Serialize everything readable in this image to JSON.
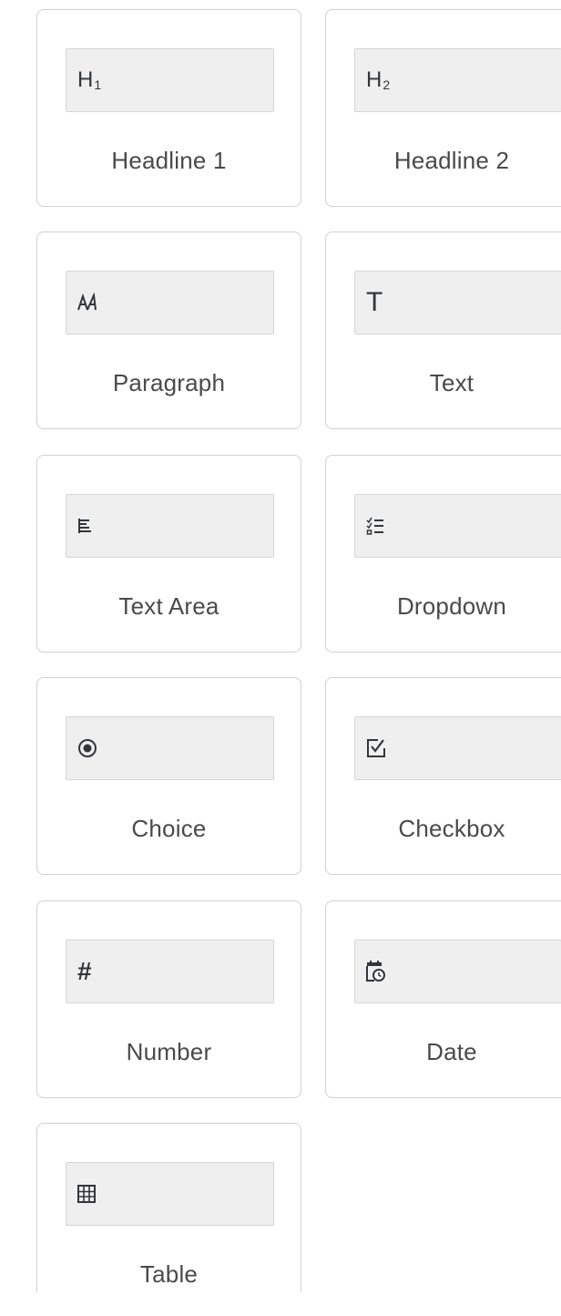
{
  "palette": {
    "items": [
      {
        "label": "Headline 1",
        "icon": "headline-1-icon",
        "icon_text": "H",
        "icon_sub": "1"
      },
      {
        "label": "Headline 2",
        "icon": "headline-2-icon",
        "icon_text": "H",
        "icon_sub": "2"
      },
      {
        "label": "Paragraph",
        "icon": "paragraph-icon"
      },
      {
        "label": "Text",
        "icon": "text-icon",
        "icon_text": "T"
      },
      {
        "label": "Text Area",
        "icon": "text-area-icon"
      },
      {
        "label": "Dropdown",
        "icon": "dropdown-list-icon"
      },
      {
        "label": "Choice",
        "icon": "radio-button-icon"
      },
      {
        "label": "Checkbox",
        "icon": "checkbox-icon"
      },
      {
        "label": "Number",
        "icon": "number-icon",
        "icon_text": "#"
      },
      {
        "label": "Date",
        "icon": "calendar-clock-icon"
      },
      {
        "label": "Table",
        "icon": "table-grid-icon"
      }
    ]
  },
  "colors": {
    "tile_border": "#d1d1d1",
    "preview_bg": "#efefef",
    "label_text": "#4a4a4a",
    "icon": "#32363a"
  }
}
